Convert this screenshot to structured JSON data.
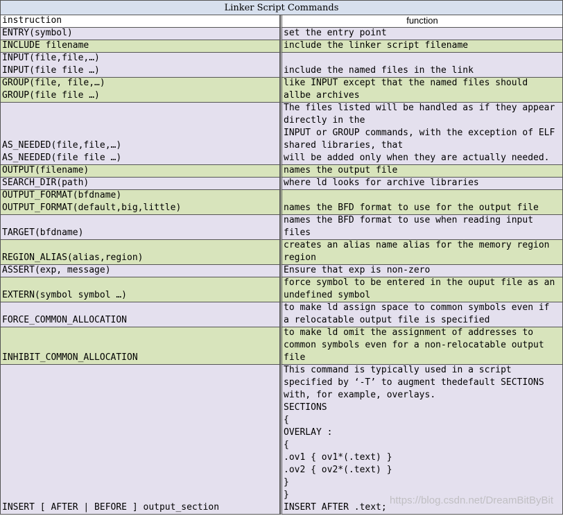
{
  "table": {
    "title": "Linker Script Commands",
    "headers": [
      "instruction",
      "function"
    ],
    "rows": [
      {
        "instruction": [
          "ENTRY(symbol)"
        ],
        "function": [
          "set the entry point"
        ]
      },
      {
        "instruction": [
          "INCLUDE filename"
        ],
        "function": [
          "include the linker script filename"
        ]
      },
      {
        "instruction": [
          "INPUT(file,file,…)",
          "INPUT(file file …)"
        ],
        "function": [
          "include the named files in the link"
        ]
      },
      {
        "instruction": [
          "GROUP(file, file,…)",
          "GROUP(file file …)"
        ],
        "function": [
          "like INPUT except that the named files should",
          "allbe archives"
        ]
      },
      {
        "instruction": [
          "AS_NEEDED(file,file,…)",
          "AS_NEEDED(file file …)"
        ],
        "function": [
          "The files listed will be handled as if they appear",
          "directly in the",
          "INPUT or GROUP commands, with the exception of ELF",
          "shared libraries, that",
          "will be added only when they are actually needed."
        ]
      },
      {
        "instruction": [
          "OUTPUT(filename)"
        ],
        "function": [
          "names the output file"
        ]
      },
      {
        "instruction": [
          "SEARCH_DIR(path)"
        ],
        "function": [
          "where ld looks for archive libraries"
        ]
      },
      {
        "instruction": [
          "OUTPUT_FORMAT(bfdname)",
          "OUTPUT_FORMAT(default,big,little)"
        ],
        "function": [
          "names the BFD format to use for the output file"
        ]
      },
      {
        "instruction": [
          "TARGET(bfdname)"
        ],
        "function": [
          "names the BFD format to use when reading input",
          "files"
        ]
      },
      {
        "instruction": [
          "REGION_ALIAS(alias,region)"
        ],
        "function": [
          "creates an alias name alias for the memory region",
          "region"
        ]
      },
      {
        "instruction": [
          "ASSERT(exp, message)"
        ],
        "function": [
          "Ensure that exp is non-zero"
        ]
      },
      {
        "instruction": [
          "EXTERN(symbol symbol …)"
        ],
        "function": [
          "force symbol to be entered in the ouput file as an",
          "undefined symbol"
        ]
      },
      {
        "instruction": [
          "FORCE_COMMON_ALLOCATION"
        ],
        "function": [
          "to make ld assign space to common symbols even if",
          "a relocatable output file is specified"
        ]
      },
      {
        "instruction": [
          "INHIBIT_COMMON_ALLOCATION"
        ],
        "function": [
          "to make ld omit the assignment of addresses to",
          "common symbols even for a non-relocatable output",
          "file"
        ]
      },
      {
        "instruction": [
          "INSERT [ AFTER | BEFORE ] output_section"
        ],
        "function": [
          "This command is typically used in a script",
          "specified by ‘-T’ to augment thedefault SECTIONS",
          "with, for example, overlays.",
          "SECTIONS",
          "{",
          "OVERLAY :",
          "{",
          ".ov1 { ov1*(.text) }",
          ".ov2 { ov2*(.text) }",
          "}",
          "}",
          "INSERT AFTER .text;"
        ]
      }
    ]
  },
  "watermark": "https://blog.csdn.net/DreamBitByBit"
}
